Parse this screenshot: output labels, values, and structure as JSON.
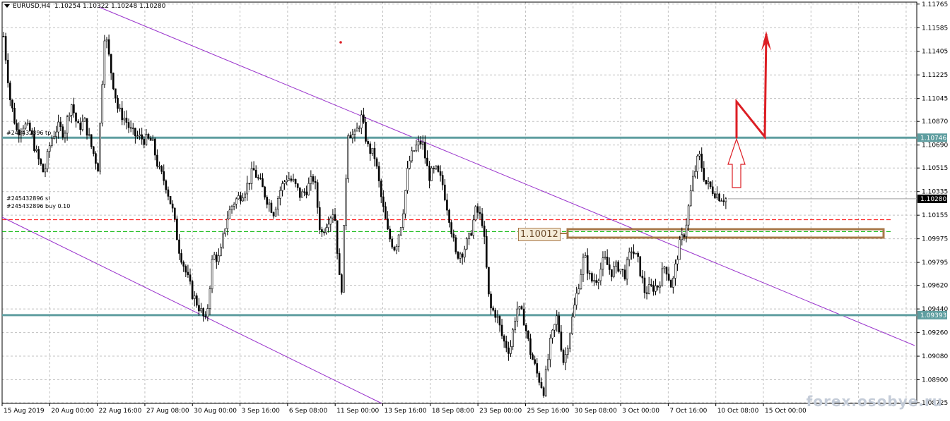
{
  "header": {
    "symbol": "EURUSD,H4",
    "ohlc": "1.10254 1.10322 1.10248 1.10280"
  },
  "orders": {
    "tp_label": "#245432896 tp",
    "sl_label": "#245432896 sl",
    "buy_label": "#245432896 buy 0.10"
  },
  "annotation": {
    "level_text": "1.10012"
  },
  "watermark": "forex.osobye.ru",
  "colors": {
    "candle": "#000000",
    "grid": "#c0c0c0",
    "level_line": "#5f9ea0",
    "channel": "#9932cc",
    "arrow": "#dc1e24",
    "sl_line": "#ff0000",
    "buy_line": "#00b400",
    "price_tag": "#000000"
  },
  "chart_data": {
    "type": "candlestick",
    "symbol": "EURUSD",
    "timeframe": "H4",
    "ylim": [
      1.0872,
      1.1178
    ],
    "price_axis_labels": [
      "1.11765",
      "1.11585",
      "1.11405",
      "1.11225",
      "1.11045",
      "1.10870",
      "1.10690",
      "1.10515",
      "1.10335",
      "1.10155",
      "1.09975",
      "1.09795",
      "1.09620",
      "1.09440",
      "1.09260",
      "1.09080",
      "1.08900",
      "1.08725"
    ],
    "time_axis_labels": [
      "15 Aug 2019",
      "20 Aug 00:00",
      "22 Aug 16:00",
      "27 Aug 08:00",
      "30 Aug 00:00",
      "3 Sep 16:00",
      "6 Sep 08:00",
      "11 Sep 00:00",
      "13 Sep 16:00",
      "18 Sep 08:00",
      "23 Sep 00:00",
      "25 Sep 16:00",
      "30 Sep 08:00",
      "3 Oct 00:00",
      "7 Oct 16:00",
      "10 Oct 08:00",
      "15 Oct 00:00"
    ],
    "price_tags": [
      {
        "label": "1.10746",
        "value": 1.10746,
        "color": "#5f9ea0"
      },
      {
        "label": "1.10280",
        "value": 1.1028,
        "color": "#000000"
      },
      {
        "label": "1.09393",
        "value": 1.09393,
        "color": "#5f9ea0"
      }
    ],
    "horizontal_levels": [
      {
        "name": "resistance",
        "value": 1.10746
      },
      {
        "name": "support",
        "value": 1.09393
      }
    ],
    "stop_loss": 1.1012,
    "buy_entry": 1.1003,
    "current_price": 1.1028,
    "zone": {
      "low": 1.0999,
      "high": 1.101
    },
    "price_path": [
      1.1152,
      1.1103,
      1.1079,
      1.1085,
      1.1079,
      1.106,
      1.1047,
      1.1073,
      1.1083,
      1.1078,
      1.1102,
      1.1082,
      1.1087,
      1.1068,
      1.1052,
      1.1157,
      1.1123,
      1.1095,
      1.1089,
      1.1078,
      1.1075,
      1.1073,
      1.1072,
      1.105,
      1.104,
      1.102,
      1.099,
      1.0972,
      1.0955,
      1.0945,
      1.0933,
      1.0985,
      1.0982,
      1.1012,
      1.1025,
      1.103,
      1.1037,
      1.105,
      1.104,
      1.1028,
      1.1018,
      1.1035,
      1.1045,
      1.104,
      1.103,
      1.1036,
      1.1045,
      1.1,
      1.1012,
      1.102,
      1.095,
      1.108,
      1.1075,
      1.109,
      1.1067,
      1.106,
      1.1027,
      1.1,
      1.099,
      1.1012,
      1.1055,
      1.1067,
      1.1072,
      1.1045,
      1.105,
      1.104,
      1.1015,
      1.0985,
      1.0988,
      1.0998,
      1.102,
      1.101,
      1.0945,
      1.094,
      1.092,
      1.0912,
      1.0945,
      1.0938,
      1.0912,
      1.0895,
      1.0882,
      1.0918,
      1.0938,
      1.0902,
      1.093,
      1.0958,
      1.0985,
      1.0965,
      1.0968,
      1.0982,
      1.0972,
      1.0977,
      1.097,
      1.099,
      1.098,
      1.0957,
      1.096,
      1.0962,
      1.0978,
      1.096,
      1.099,
      1.1005,
      1.104,
      1.1062,
      1.104,
      1.1035,
      1.103,
      1.1028
    ]
  }
}
